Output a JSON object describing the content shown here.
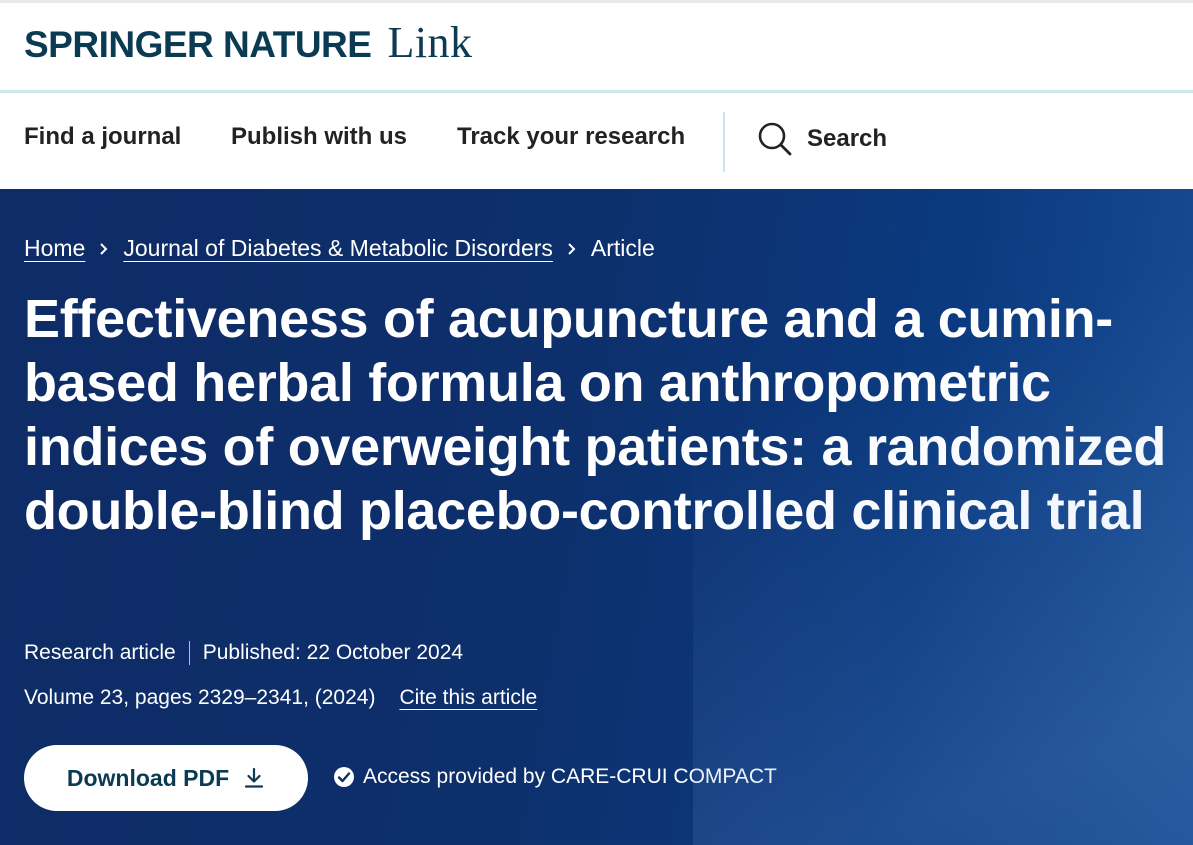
{
  "brand": {
    "name": "SPRINGER NATURE",
    "product": "Link"
  },
  "nav": {
    "items": [
      {
        "label": "Find a journal"
      },
      {
        "label": "Publish with us"
      },
      {
        "label": "Track your research"
      }
    ],
    "search_label": "Search"
  },
  "breadcrumb": {
    "home": "Home",
    "journal": "Journal of Diabetes & Metabolic Disorders",
    "current": "Article"
  },
  "article": {
    "title": "Effectiveness of acupuncture and a cumin-based herbal formula on anthropometric indices of overweight patients: a randomized double-blind placebo-controlled clinical trial",
    "type": "Research article",
    "published": "Published: 22 October 2024",
    "citation": "Volume 23, pages 2329–2341, (2024)",
    "cite_label": "Cite this article"
  },
  "actions": {
    "download_label": "Download PDF",
    "access_text": "Access provided by CARE-CRUI COMPACT"
  },
  "colors": {
    "brand_text": "#0b3a53",
    "hero_bg": "#0d2f6b",
    "divider": "#cfe4ef"
  },
  "icons": {
    "search": "search-icon",
    "chevron": "chevron-right-icon",
    "download": "download-icon",
    "check": "check-circle-icon"
  }
}
